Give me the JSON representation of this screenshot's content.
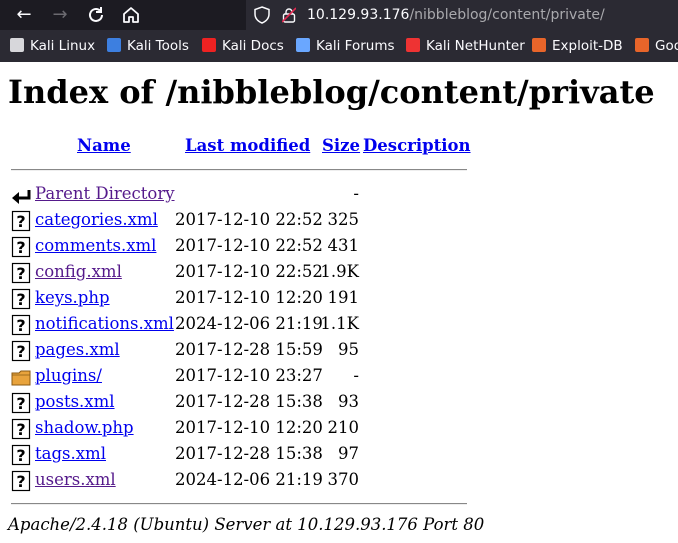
{
  "browser": {
    "url_host": "10.129.93.176",
    "url_path": "/nibbleblog/content/private/",
    "bookmarks": [
      {
        "label": "Kali Linux",
        "icon": "kali-dragon-icon",
        "color": "#d7d7db"
      },
      {
        "label": "Kali Tools",
        "icon": "kali-tools-icon",
        "color": "#3d7fe0"
      },
      {
        "label": "Kali Docs",
        "icon": "kali-docs-icon",
        "color": "#e22"
      },
      {
        "label": "Kali Forums",
        "icon": "kali-forums-icon",
        "color": "#6aa7ff"
      },
      {
        "label": "Kali NetHunter",
        "icon": "kali-nethunter-icon",
        "color": "#e33"
      },
      {
        "label": "Exploit-DB",
        "icon": "exploit-db-icon",
        "color": "#e8652a"
      },
      {
        "label": "Goo",
        "icon": "google-hacking-db-icon",
        "color": "#e8652a"
      }
    ]
  },
  "page": {
    "title": "Index of /nibbleblog/content/private",
    "columns": {
      "name": "Name",
      "modified": "Last modified",
      "size": "Size",
      "description": "Description"
    },
    "entries": [
      {
        "name": "Parent Directory",
        "date": "",
        "size": "-",
        "icon": "parent-directory-icon",
        "visited": true
      },
      {
        "name": "categories.xml",
        "date": "2017-12-10 22:52",
        "size": "325",
        "icon": "unknown-file-icon",
        "visited": false
      },
      {
        "name": "comments.xml",
        "date": "2017-12-10 22:52",
        "size": "431",
        "icon": "unknown-file-icon",
        "visited": false
      },
      {
        "name": "config.xml",
        "date": "2017-12-10 22:52",
        "size": "1.9K",
        "icon": "unknown-file-icon",
        "visited": true
      },
      {
        "name": "keys.php",
        "date": "2017-12-10 12:20",
        "size": "191",
        "icon": "unknown-file-icon",
        "visited": false
      },
      {
        "name": "notifications.xml",
        "date": "2024-12-06 21:19",
        "size": "1.1K",
        "icon": "unknown-file-icon",
        "visited": false
      },
      {
        "name": "pages.xml",
        "date": "2017-12-28 15:59",
        "size": "95",
        "icon": "unknown-file-icon",
        "visited": false
      },
      {
        "name": "plugins/",
        "date": "2017-12-10 23:27",
        "size": "-",
        "icon": "folder-icon",
        "visited": false
      },
      {
        "name": "posts.xml",
        "date": "2017-12-28 15:38",
        "size": "93",
        "icon": "unknown-file-icon",
        "visited": false
      },
      {
        "name": "shadow.php",
        "date": "2017-12-10 12:20",
        "size": "210",
        "icon": "unknown-file-icon",
        "visited": false
      },
      {
        "name": "tags.xml",
        "date": "2017-12-28 15:38",
        "size": "97",
        "icon": "unknown-file-icon",
        "visited": false
      },
      {
        "name": "users.xml",
        "date": "2024-12-06 21:19",
        "size": "370",
        "icon": "unknown-file-icon",
        "visited": true
      }
    ],
    "footer": "Apache/2.4.18 (Ubuntu) Server at 10.129.93.176 Port 80"
  }
}
